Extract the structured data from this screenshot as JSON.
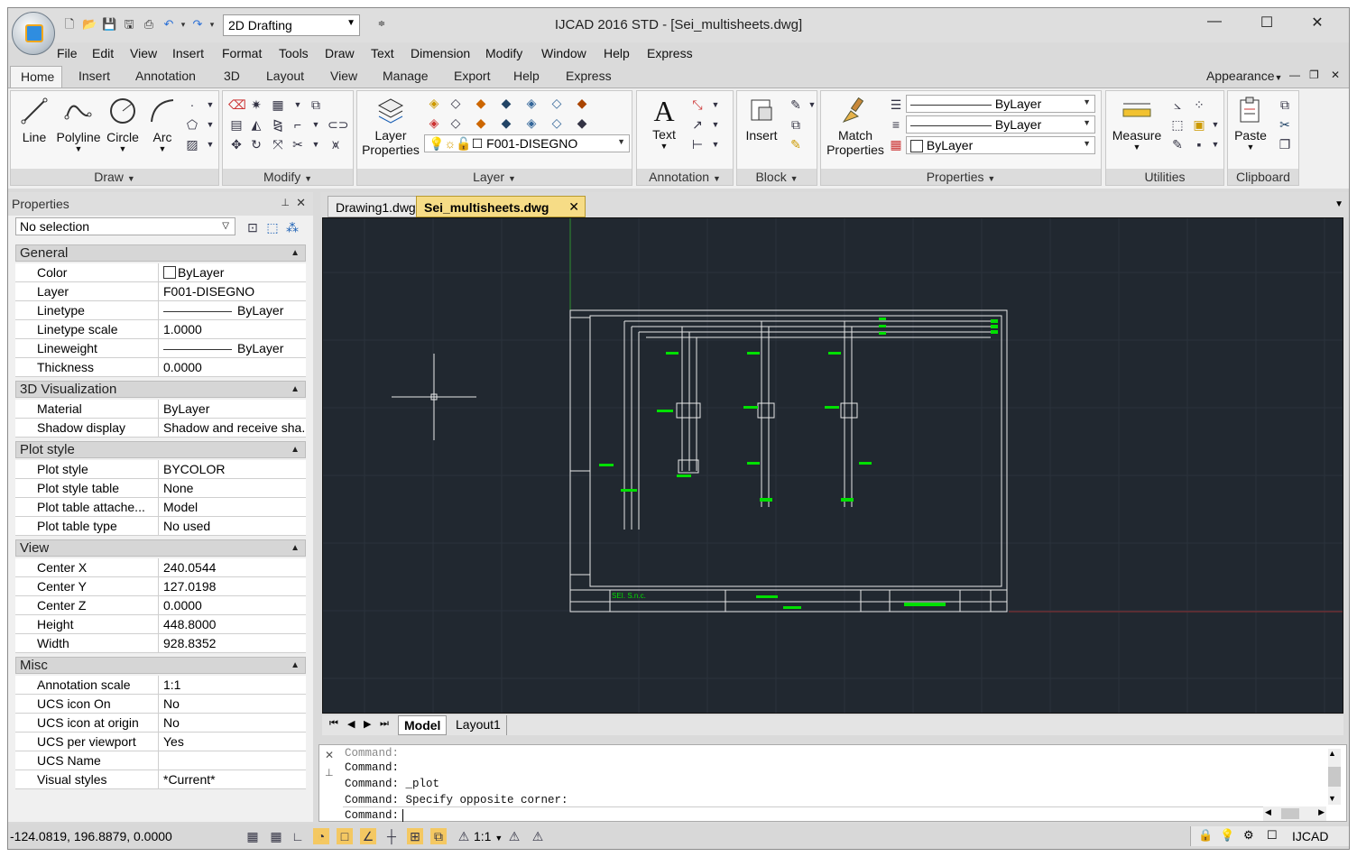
{
  "quick_access": {
    "workspace": "2D Drafting"
  },
  "window": {
    "title": "IJCAD 2016 STD - [Sei_multisheets.dwg]"
  },
  "menus": [
    "File",
    "Edit",
    "View",
    "Insert",
    "Format",
    "Tools",
    "Draw",
    "Text",
    "Dimension",
    "Modify",
    "Window",
    "Help",
    "Express"
  ],
  "ribbon_tabs": [
    "Home",
    "Insert",
    "Annotation",
    "3D",
    "Layout",
    "View",
    "Manage",
    "Export",
    "Help",
    "Express"
  ],
  "appearance_label": "Appearance",
  "ribbon": {
    "draw": {
      "label": "Draw",
      "line": "Line",
      "polyline": "Polyline",
      "circle": "Circle",
      "arc": "Arc"
    },
    "modify": {
      "label": "Modify"
    },
    "layer": {
      "label": "Layer",
      "layer_properties_1": "Layer",
      "layer_properties_2": "Properties",
      "current_layer": "F001-DISEGNO"
    },
    "annotation": {
      "label": "Annotation",
      "text": "Text"
    },
    "block": {
      "label": "Block",
      "insert": "Insert"
    },
    "properties": {
      "label": "Properties",
      "match_1": "Match",
      "match_2": "Properties",
      "linetype": "ByLayer",
      "lineweight": "ByLayer",
      "color": "ByLayer"
    },
    "utilities": {
      "label": "Utilities",
      "measure": "Measure"
    },
    "clipboard": {
      "label": "Clipboard",
      "paste": "Paste"
    }
  },
  "properties_palette": {
    "title": "Properties",
    "selection": "No selection",
    "sections": {
      "general": {
        "title": "General",
        "rows": [
          [
            "Color",
            "ByLayer"
          ],
          [
            "Layer",
            "F001-DISEGNO"
          ],
          [
            "Linetype",
            "ByLayer"
          ],
          [
            "Linetype scale",
            "1.0000"
          ],
          [
            "Lineweight",
            "ByLayer"
          ],
          [
            "Thickness",
            "0.0000"
          ]
        ]
      },
      "viz": {
        "title": "3D Visualization",
        "rows": [
          [
            "Material",
            "ByLayer"
          ],
          [
            "Shadow display",
            "Shadow and receive sha..."
          ]
        ]
      },
      "plot": {
        "title": "Plot style",
        "rows": [
          [
            "Plot style",
            "BYCOLOR"
          ],
          [
            "Plot style table",
            "None"
          ],
          [
            "Plot table attache...",
            "Model"
          ],
          [
            "Plot table type",
            "No used"
          ]
        ]
      },
      "view": {
        "title": "View",
        "rows": [
          [
            "Center X",
            "240.0544"
          ],
          [
            "Center Y",
            "127.0198"
          ],
          [
            "Center Z",
            "0.0000"
          ],
          [
            "Height",
            "448.8000"
          ],
          [
            "Width",
            "928.8352"
          ]
        ]
      },
      "misc": {
        "title": "Misc",
        "rows": [
          [
            "Annotation scale",
            "1:1"
          ],
          [
            "UCS icon On",
            "No"
          ],
          [
            "UCS icon at origin",
            "No"
          ],
          [
            "UCS per viewport",
            "Yes"
          ],
          [
            "UCS Name",
            ""
          ],
          [
            "Visual styles",
            "*Current*"
          ]
        ]
      }
    }
  },
  "doc_tabs": [
    "Drawing1.dwg",
    "Sei_multisheets.dwg"
  ],
  "layout_tabs": [
    "Model",
    "Layout1"
  ],
  "drawing": {
    "company": "SEI. S.n.c."
  },
  "command_history": [
    "Command:",
    "Command: _plot",
    "Command: Specify opposite corner:"
  ],
  "command_prompt": "Command:",
  "status": {
    "coords": "-124.0819, 196.8879, 0.0000",
    "scale": "1:1",
    "app": "IJCAD"
  }
}
